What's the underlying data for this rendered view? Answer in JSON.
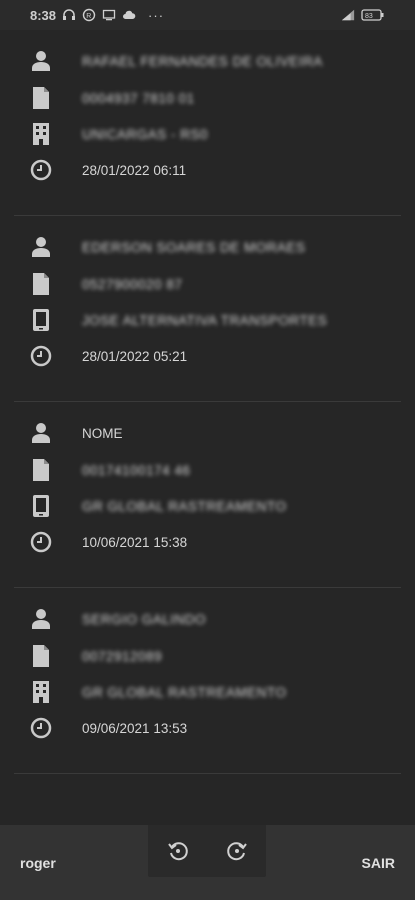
{
  "statusbar": {
    "time": "8:38",
    "dots": "···",
    "battery": "83"
  },
  "entries": [
    {
      "name": "RAFAEL FERNANDES DE OLIVEIRA",
      "document": "0004937 7810 01",
      "company": "UNICARGAS - RS0",
      "datetime": "28/01/2022 06:11"
    },
    {
      "name": "EDERSON SOARES DE MORAES",
      "document": "0527900020 87",
      "company": "JOSE ALTERNATIVA TRANSPORTES",
      "datetime": "28/01/2022 05:21"
    },
    {
      "name": "NOME",
      "document": "00174100174 46",
      "company": "GR GLOBAL RASTREAMENTO",
      "datetime": "10/06/2021 15:38"
    },
    {
      "name": "SERGIO GALINDO",
      "document": "0072912089",
      "company": "GR GLOBAL RASTREAMENTO",
      "datetime": "09/06/2021 13:53"
    }
  ],
  "footer": {
    "user": "roger",
    "logout_label": "SAIR"
  },
  "icons": {
    "person": "person-icon",
    "document": "document-icon",
    "building": "building-icon",
    "clock": "clock-icon",
    "rotate_left": "rotate-left-icon",
    "rotate_right": "rotate-right-icon"
  }
}
